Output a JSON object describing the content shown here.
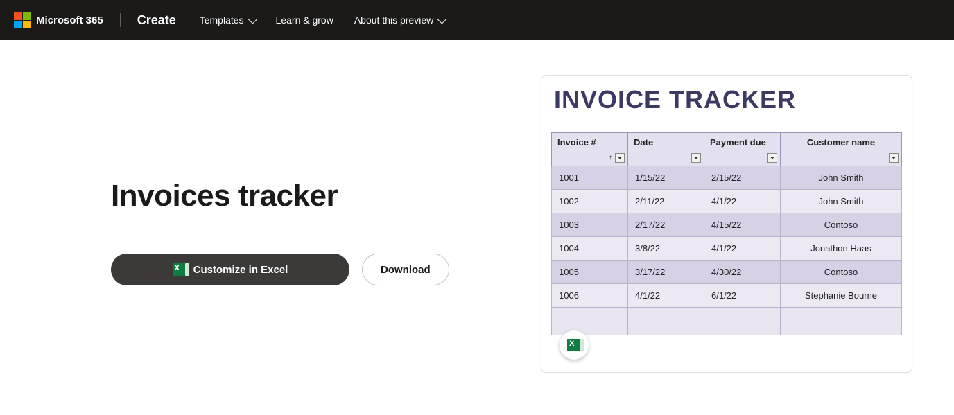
{
  "header": {
    "brand": "Microsoft 365",
    "create": "Create",
    "nav": {
      "templates": "Templates",
      "learn": "Learn & grow",
      "about": "About this preview"
    }
  },
  "page": {
    "title": "Invoices tracker",
    "customize_btn": "Customize in Excel",
    "download_btn": "Download"
  },
  "preview": {
    "title": "INVOICE TRACKER",
    "columns": {
      "invoice": "Invoice #",
      "date": "Date",
      "payment_due": "Payment due",
      "customer": "Customer name"
    },
    "rows": [
      {
        "invoice": "1001",
        "date": "1/15/22",
        "due": "2/15/22",
        "customer": "John Smith"
      },
      {
        "invoice": "1002",
        "date": "2/11/22",
        "due": "4/1/22",
        "customer": "John Smith"
      },
      {
        "invoice": "1003",
        "date": "2/17/22",
        "due": "4/15/22",
        "customer": "Contoso"
      },
      {
        "invoice": "1004",
        "date": "3/8/22",
        "due": "4/1/22",
        "customer": "Jonathon Haas"
      },
      {
        "invoice": "1005",
        "date": "3/17/22",
        "due": "4/30/22",
        "customer": "Contoso"
      },
      {
        "invoice": "1006",
        "date": "4/1/22",
        "due": "6/1/22",
        "customer": "Stephanie Bourne"
      }
    ]
  }
}
